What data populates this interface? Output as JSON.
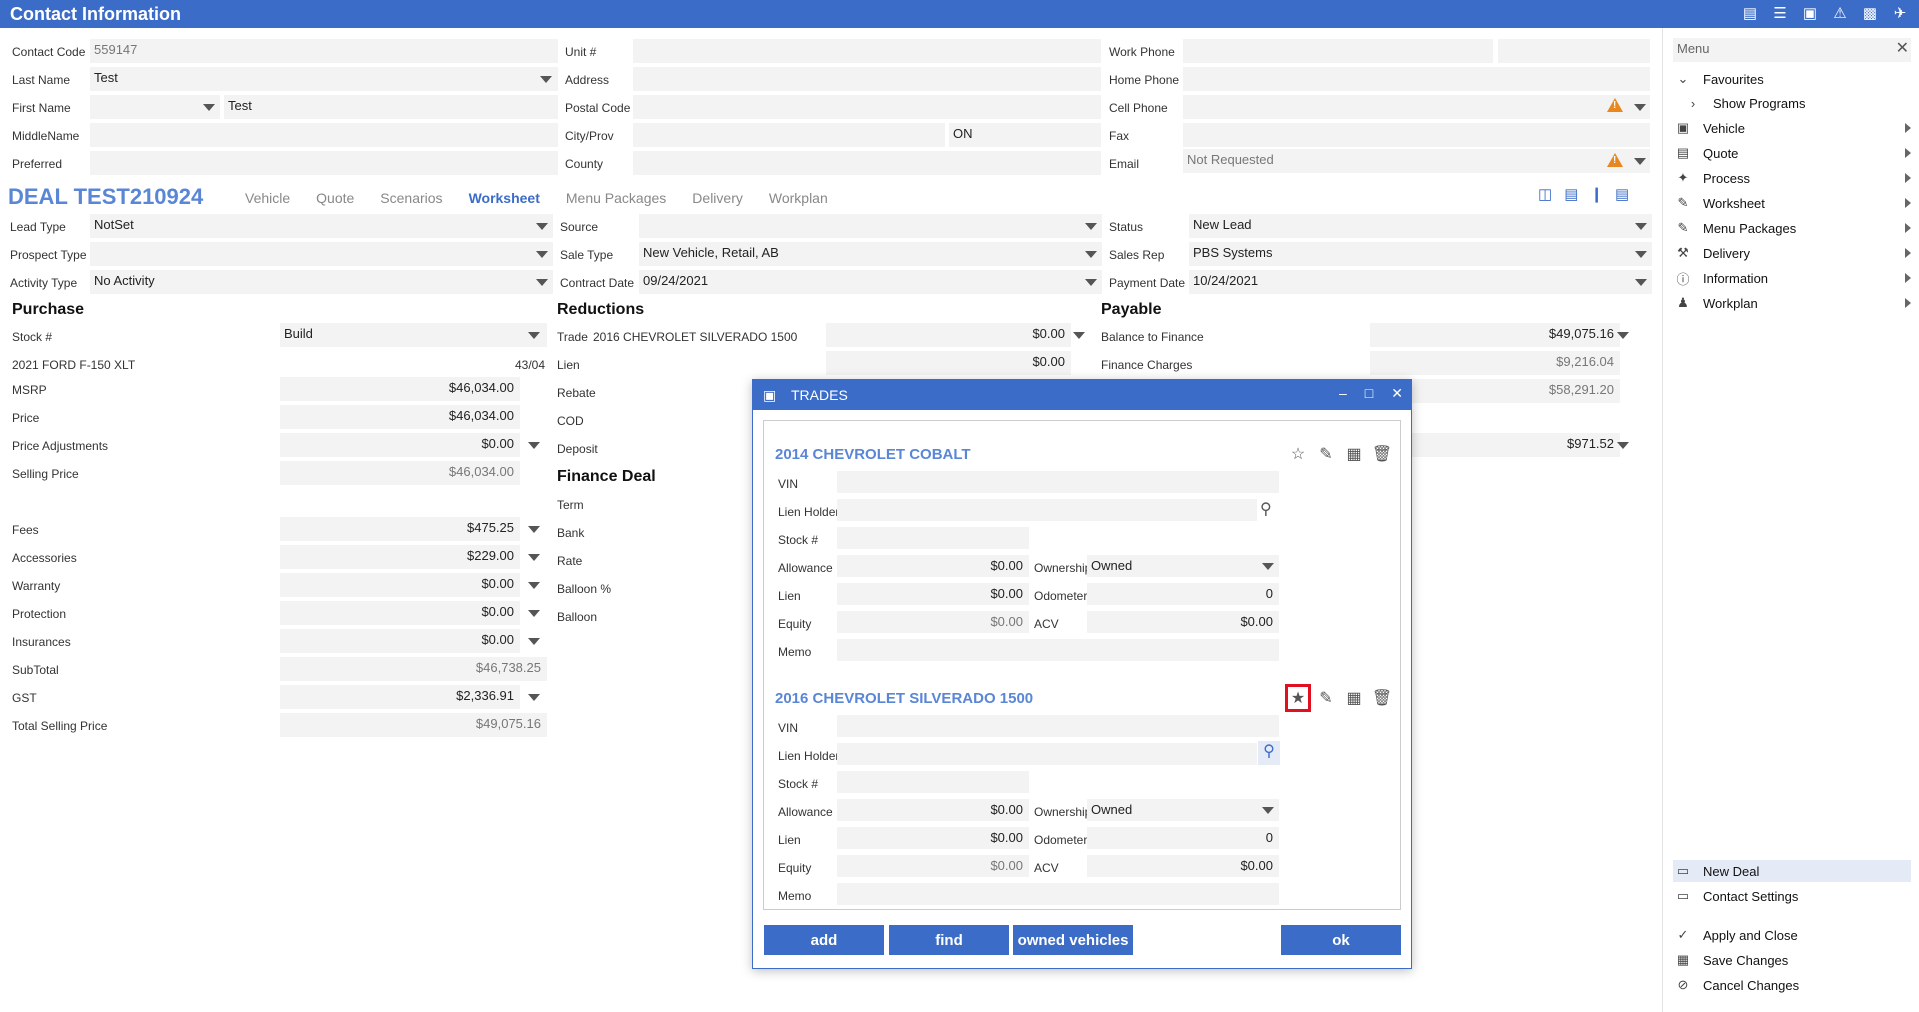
{
  "title": "Contact Information",
  "contact": {
    "contact_code_label": "Contact Code",
    "contact_code": "559147",
    "last_name_label": "Last Name",
    "last_name": "Test",
    "first_name_label": "First Name",
    "first_name": "Test",
    "middle_name_label": "MiddleName",
    "preferred_label": "Preferred",
    "unit_label": "Unit #",
    "address_label": "Address",
    "postal_label": "Postal Code",
    "city_label": "City/Prov",
    "province": "ON",
    "county_label": "County",
    "work_phone_label": "Work Phone",
    "home_phone_label": "Home Phone",
    "cell_phone_label": "Cell Phone",
    "fax_label": "Fax",
    "email_label": "Email",
    "email": "Not Requested"
  },
  "deal": {
    "title": "DEAL TEST210924",
    "tabs": [
      "Vehicle",
      "Quote",
      "Scenarios",
      "Worksheet",
      "Menu Packages",
      "Delivery",
      "Workplan"
    ],
    "active_tab": "Worksheet",
    "lead_type_label": "Lead Type",
    "lead_type": "NotSet",
    "prospect_type_label": "Prospect Type",
    "activity_type_label": "Activity Type",
    "activity_type": "No Activity",
    "source_label": "Source",
    "sale_type_label": "Sale Type",
    "sale_type": "New Vehicle, Retail, AB",
    "contract_date_label": "Contract Date",
    "contract_date": "09/24/2021",
    "status_label": "Status",
    "status": "New Lead",
    "sales_rep_label": "Sales Rep",
    "sales_rep": "PBS Systems",
    "payment_date_label": "Payment Date",
    "payment_date": "10/24/2021"
  },
  "purchase": {
    "heading": "Purchase",
    "stock_label": "Stock #",
    "stock": "Build",
    "vehicle": "2021 FORD F-150 XLT",
    "vehicle_code": "43/04",
    "msrp_label": "MSRP",
    "msrp": "$46,034.00",
    "price_label": "Price",
    "price": "$46,034.00",
    "price_adj_label": "Price Adjustments",
    "price_adj": "$0.00",
    "selling_label": "Selling Price",
    "selling": "$46,034.00",
    "fees_label": "Fees",
    "fees": "$475.25",
    "accessories_label": "Accessories",
    "accessories": "$229.00",
    "warranty_label": "Warranty",
    "warranty": "$0.00",
    "protection_label": "Protection",
    "protection": "$0.00",
    "insurances_label": "Insurances",
    "insurances": "$0.00",
    "subtotal_label": "SubTotal",
    "subtotal": "$46,738.25",
    "gst_label": "GST",
    "gst": "$2,336.91",
    "total_label": "Total Selling Price",
    "total": "$49,075.16"
  },
  "reductions": {
    "heading": "Reductions",
    "trade_label": "Trade",
    "trade_vehicle": "2016 CHEVROLET SILVERADO 1500",
    "trade": "$0.00",
    "lien_label": "Lien",
    "lien": "$0.00",
    "rebate_label": "Rebate",
    "cod_label": "COD",
    "deposit_label": "Deposit",
    "finance_heading": "Finance Deal",
    "term_label": "Term",
    "bank_label": "Bank",
    "rate_label": "Rate",
    "balloon_pct_label": "Balloon %",
    "balloon_label": "Balloon"
  },
  "payable": {
    "heading": "Payable",
    "balance_label": "Balance to Finance",
    "balance": "$49,075.16",
    "finance_charges_label": "Finance Charges",
    "finance_charges": "$9,216.04",
    "total": "$58,291.20",
    "payment": "$971.52"
  },
  "dialog": {
    "title": "TRADES",
    "trades": [
      {
        "name": "2014 CHEVROLET COBALT",
        "vin_label": "VIN",
        "lien_holders_label": "Lien Holders",
        "stock_label": "Stock #",
        "allowance_label": "Allowance",
        "allowance": "$0.00",
        "ownership_label": "Ownership",
        "ownership": "Owned",
        "lien_label": "Lien",
        "lien": "$0.00",
        "odometer_label": "Odometer",
        "odometer": "0",
        "equity_label": "Equity",
        "equity": "$0.00",
        "acv_label": "ACV",
        "acv": "$0.00",
        "memo_label": "Memo"
      },
      {
        "name": "2016 CHEVROLET SILVERADO 1500",
        "vin_label": "VIN",
        "lien_holders_label": "Lien Holders",
        "stock_label": "Stock #",
        "allowance_label": "Allowance",
        "allowance": "$0.00",
        "ownership_label": "Ownership",
        "ownership": "Owned",
        "lien_label": "Lien",
        "lien": "$0.00",
        "odometer_label": "Odometer",
        "odometer": "0",
        "equity_label": "Equity",
        "equity": "$0.00",
        "acv_label": "ACV",
        "acv": "$0.00",
        "memo_label": "Memo"
      }
    ],
    "buttons": {
      "add": "add",
      "find": "find",
      "owned": "owned vehicles",
      "ok": "ok"
    }
  },
  "menu": {
    "placeholder": "Menu",
    "favourites": "Favourites",
    "show_programs": "Show Programs",
    "items": [
      "Vehicle",
      "Quote",
      "Process",
      "Worksheet",
      "Menu Packages",
      "Delivery",
      "Information",
      "Workplan"
    ],
    "bottom": [
      "New Deal",
      "Contact Settings"
    ],
    "actions": [
      "Apply and Close",
      "Save Changes",
      "Cancel Changes"
    ]
  }
}
